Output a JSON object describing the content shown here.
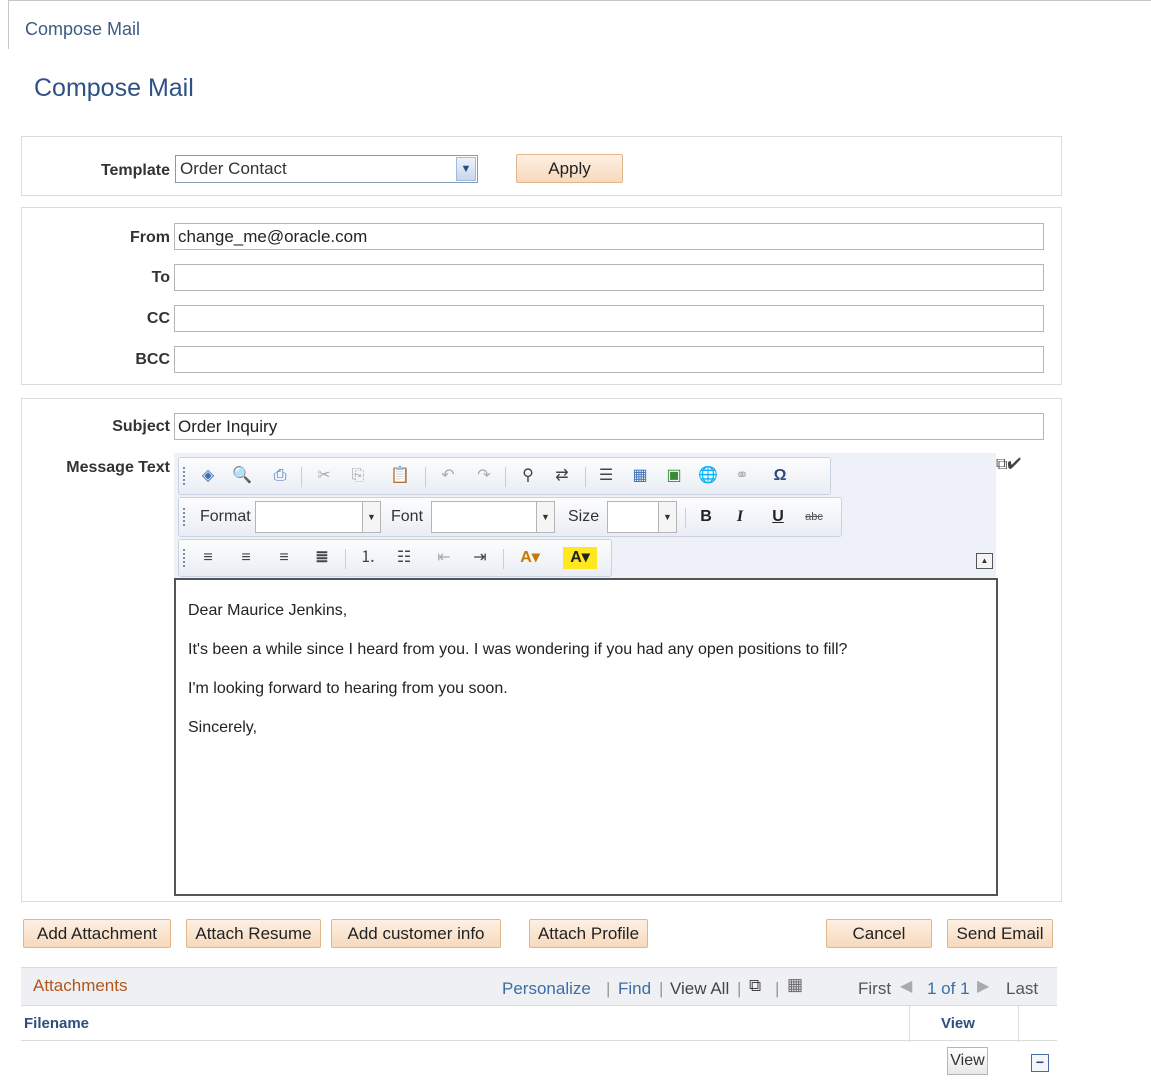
{
  "breadcrumb": "Compose Mail",
  "page_title": "Compose Mail",
  "template": {
    "label": "Template",
    "value": "Order Contact",
    "apply_label": "Apply"
  },
  "fields": {
    "from_label": "From",
    "from_value": "change_me@oracle.com",
    "to_label": "To",
    "to_value": "",
    "cc_label": "CC",
    "cc_value": "",
    "bcc_label": "BCC",
    "bcc_value": ""
  },
  "subject": {
    "label": "Subject",
    "value": "Order Inquiry"
  },
  "message": {
    "label": "Message Text",
    "toolbar": {
      "format_label": "Format",
      "font_label": "Font",
      "size_label": "Size"
    },
    "lines": [
      "Dear Maurice Jenkins,",
      "It's been a while since I heard from you.  I was wondering if you had any open positions to fill?",
      "I'm looking forward to hearing from you soon.",
      "Sincerely,"
    ]
  },
  "buttons": {
    "add_attachment": "Add Attachment",
    "attach_resume": "Attach Resume",
    "add_customer_info": "Add customer info",
    "attach_profile": "Attach Profile",
    "cancel": "Cancel",
    "send_email": "Send Email"
  },
  "attachments": {
    "title": "Attachments",
    "personalize": "Personalize",
    "find": "Find",
    "view_all": "View All",
    "first": "First",
    "range": "1 of 1",
    "last": "Last",
    "col_filename": "Filename",
    "col_view": "View",
    "row_view_button": "View"
  }
}
